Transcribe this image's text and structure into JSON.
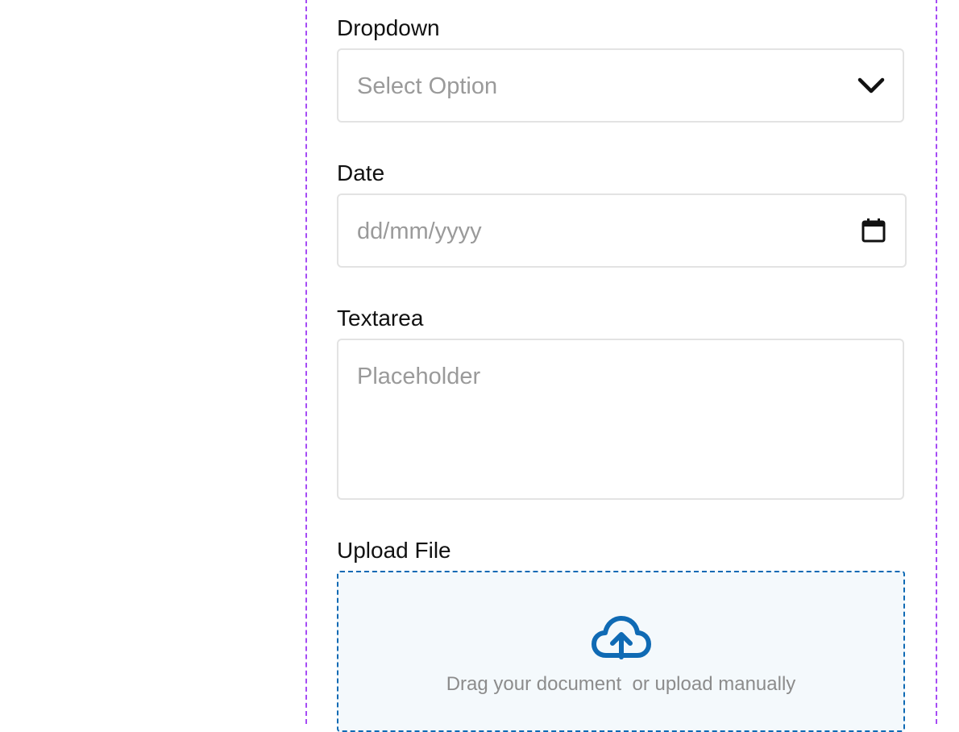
{
  "dropdown": {
    "label": "Dropdown",
    "placeholder": "Select Option",
    "icon": "chevron-down-icon"
  },
  "date": {
    "label": "Date",
    "placeholder": "dd/mm/yyyy",
    "icon": "calendar-icon"
  },
  "textarea": {
    "label": "Textarea",
    "placeholder": "Placeholder"
  },
  "upload": {
    "label": "Upload File",
    "hint": "Drag your document  or upload manually",
    "icon": "cloud-upload-icon"
  },
  "colors": {
    "frame_border": "#a64bf4",
    "upload_accent": "#0f6ab4",
    "upload_background": "#f4f9fc",
    "input_border": "#e3e3e3",
    "placeholder_text": "#9a9a9a"
  }
}
